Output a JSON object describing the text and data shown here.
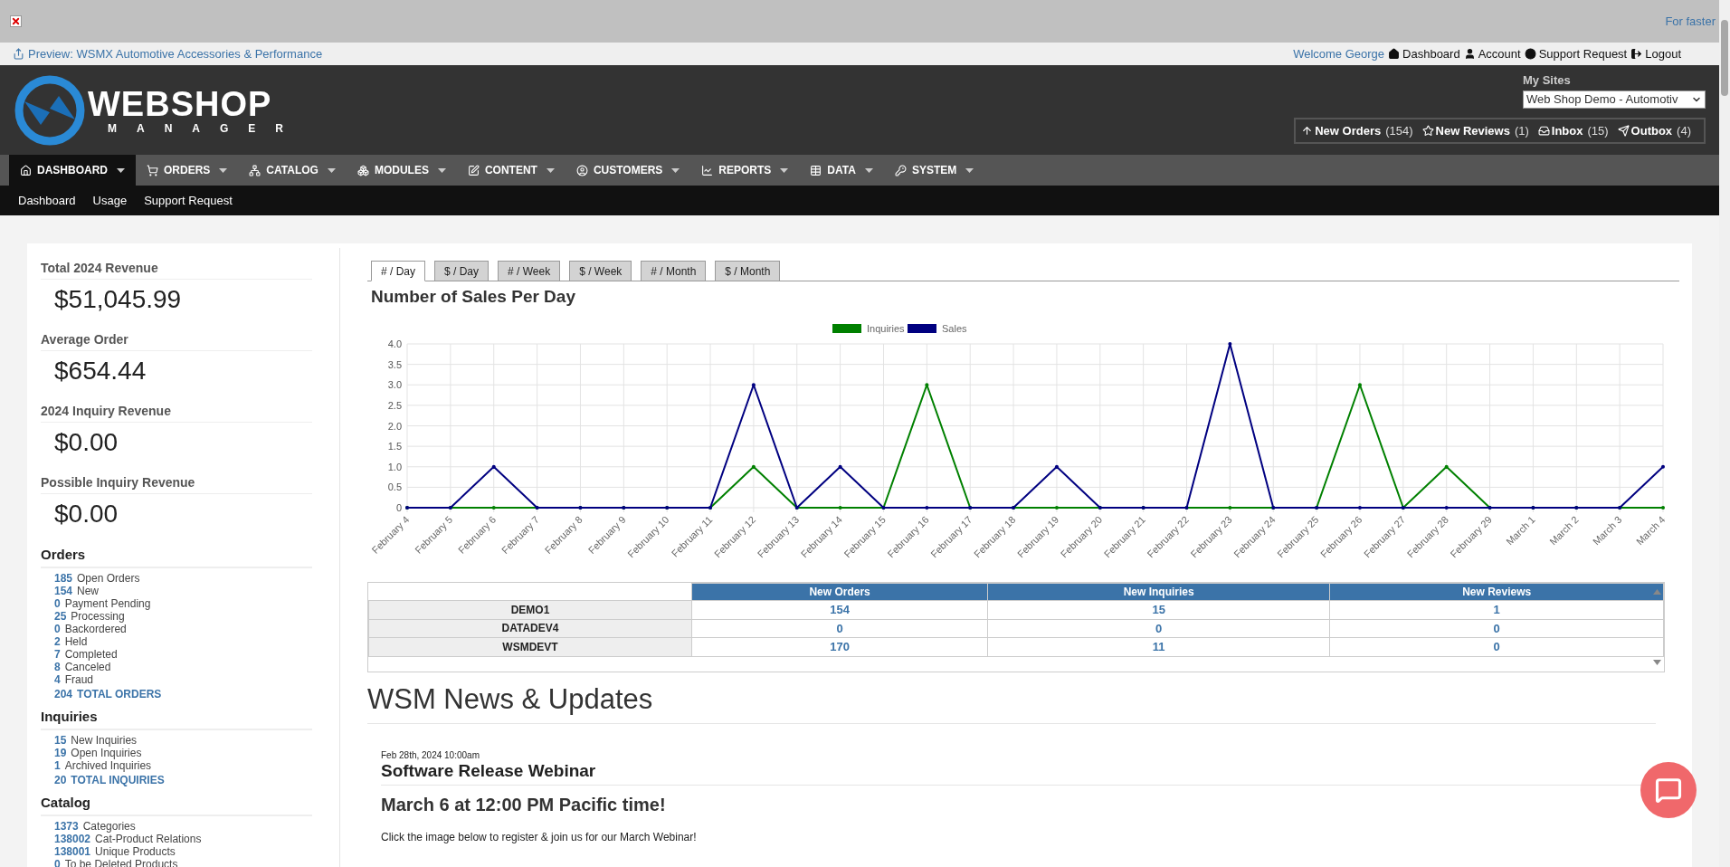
{
  "top_bar": {
    "notice": "For faster"
  },
  "preview_bar": {
    "preview_link": "Preview: WSMX Automotive Accessories & Performance",
    "welcome": "Welcome George",
    "links": [
      "Dashboard",
      "Account",
      "Support Request",
      "Logout"
    ]
  },
  "header": {
    "logo": {
      "name": "WEBSHOP",
      "sub": "MANAGER"
    },
    "my_sites": {
      "label": "My Sites",
      "value": "Web Shop Demo - Automotiv"
    },
    "counters": [
      {
        "label": "New Orders",
        "count": "(154)"
      },
      {
        "label": "New Reviews",
        "count": "(1)"
      },
      {
        "label": "Inbox",
        "count": "(15)"
      },
      {
        "label": "Outbox",
        "count": "(4)"
      }
    ]
  },
  "nav": [
    {
      "label": "DASHBOARD",
      "selected": true
    },
    {
      "label": "ORDERS",
      "selected": false
    },
    {
      "label": "CATALOG",
      "selected": false
    },
    {
      "label": "MODULES",
      "selected": false
    },
    {
      "label": "CONTENT",
      "selected": false
    },
    {
      "label": "CUSTOMERS",
      "selected": false
    },
    {
      "label": "REPORTS",
      "selected": false
    },
    {
      "label": "DATA",
      "selected": false
    },
    {
      "label": "SYSTEM",
      "selected": false
    }
  ],
  "subnav": [
    "Dashboard",
    "Usage",
    "Support Request"
  ],
  "stats": [
    {
      "title": "Total 2024 Revenue",
      "value": "$51,045.99"
    },
    {
      "title": "Average Order",
      "value": "$654.44"
    },
    {
      "title": "2024 Inquiry Revenue",
      "value": "$0.00"
    },
    {
      "title": "Possible Inquiry Revenue",
      "value": "$0.00"
    }
  ],
  "sections": [
    {
      "title": "Orders",
      "items": [
        {
          "kind": "count",
          "count": "185",
          "label": "Open Orders"
        },
        {
          "kind": "count",
          "count": "154",
          "label": "New"
        },
        {
          "kind": "count",
          "count": "0",
          "label": "Payment Pending"
        },
        {
          "kind": "count",
          "count": "25",
          "label": "Processing"
        },
        {
          "kind": "count",
          "count": "0",
          "label": "Backordered"
        },
        {
          "kind": "count",
          "count": "2",
          "label": "Held"
        },
        {
          "kind": "count",
          "count": "7",
          "label": "Completed"
        },
        {
          "kind": "count",
          "count": "8",
          "label": "Canceled"
        },
        {
          "kind": "count",
          "count": "4",
          "label": "Fraud"
        },
        {
          "kind": "total",
          "count": "204",
          "label": "TOTAL ORDERS"
        }
      ]
    },
    {
      "title": "Inquiries",
      "items": [
        {
          "kind": "count",
          "count": "15",
          "label": "New Inquiries"
        },
        {
          "kind": "count",
          "count": "19",
          "label": "Open Inquiries"
        },
        {
          "kind": "count",
          "count": "1",
          "label": "Archived Inquiries"
        },
        {
          "kind": "total",
          "count": "20",
          "label": "TOTAL INQUIRIES"
        }
      ]
    },
    {
      "title": "Catalog",
      "items": [
        {
          "kind": "count",
          "count": "1373",
          "label": "Categories"
        },
        {
          "kind": "count",
          "count": "138002",
          "label": "Cat-Product Relations"
        },
        {
          "kind": "count",
          "count": "138001",
          "label": "Unique Products"
        },
        {
          "kind": "count",
          "count": "0",
          "label": "To be Deleted Products"
        }
      ]
    }
  ],
  "chart_tabs": [
    {
      "label": "# / Day",
      "selected": true
    },
    {
      "label": "$ / Day",
      "selected": false
    },
    {
      "label": "# / Week",
      "selected": false
    },
    {
      "label": "$ / Week",
      "selected": false
    },
    {
      "label": "# / Month",
      "selected": false
    },
    {
      "label": "$ / Month",
      "selected": false
    }
  ],
  "chart_title": "Number of Sales Per Day",
  "chart_data": {
    "type": "line",
    "grid": true,
    "legend": true,
    "categories": [
      "February 4",
      "February 5",
      "February 6",
      "February 7",
      "February 8",
      "February 9",
      "February 10",
      "February 11",
      "February 12",
      "February 13",
      "February 14",
      "February 15",
      "February 16",
      "February 17",
      "February 18",
      "February 19",
      "February 20",
      "February 21",
      "February 22",
      "February 23",
      "February 24",
      "February 25",
      "February 26",
      "February 27",
      "February 28",
      "February 29",
      "March 1",
      "March 2",
      "March 3",
      "March 4"
    ],
    "ylim": [
      0,
      4
    ],
    "yticks": [
      {
        "value": 0,
        "label": "0"
      },
      {
        "value": 0.5,
        "label": "0.5"
      },
      {
        "value": 1,
        "label": "1.0"
      },
      {
        "value": 1.5,
        "label": "1.5"
      },
      {
        "value": 2,
        "label": "2.0"
      },
      {
        "value": 2.5,
        "label": "2.5"
      },
      {
        "value": 3,
        "label": "3.0"
      },
      {
        "value": 3.5,
        "label": "3.5"
      },
      {
        "value": 4,
        "label": "4.0"
      }
    ],
    "series": [
      {
        "name": "Inquiries",
        "color": "#008000",
        "values": [
          0,
          0,
          0,
          0,
          0,
          0,
          0,
          0,
          1,
          0,
          0,
          0,
          3,
          0,
          0,
          0,
          0,
          0,
          0,
          0,
          0,
          0,
          3,
          0,
          1,
          0,
          0,
          0,
          0,
          0
        ]
      },
      {
        "name": "Sales",
        "color": "#000080",
        "values": [
          0,
          0,
          1,
          0,
          0,
          0,
          0,
          0,
          3,
          0,
          1,
          0,
          0,
          0,
          0,
          1,
          0,
          0,
          0,
          4,
          0,
          0,
          0,
          0,
          0,
          0,
          0,
          0,
          0,
          1
        ]
      }
    ]
  },
  "site_table": {
    "columns": [
      "New Orders",
      "New Inquiries",
      "New Reviews"
    ],
    "rows": [
      {
        "site": "DEMO1",
        "values": [
          "154",
          "15",
          "1"
        ]
      },
      {
        "site": "DATADEV4",
        "values": [
          "0",
          "0",
          "0"
        ]
      },
      {
        "site": "WSMDEVT",
        "values": [
          "170",
          "11",
          "0"
        ]
      }
    ]
  },
  "news": {
    "heading": "WSM News & Updates",
    "date": "Feb 28th, 2024 10:00am",
    "title": "Software Release Webinar",
    "subtitle": "March 6 at 12:00 PM Pacific time!",
    "body": "Click the image below to register & join us for our March Webinar!"
  }
}
